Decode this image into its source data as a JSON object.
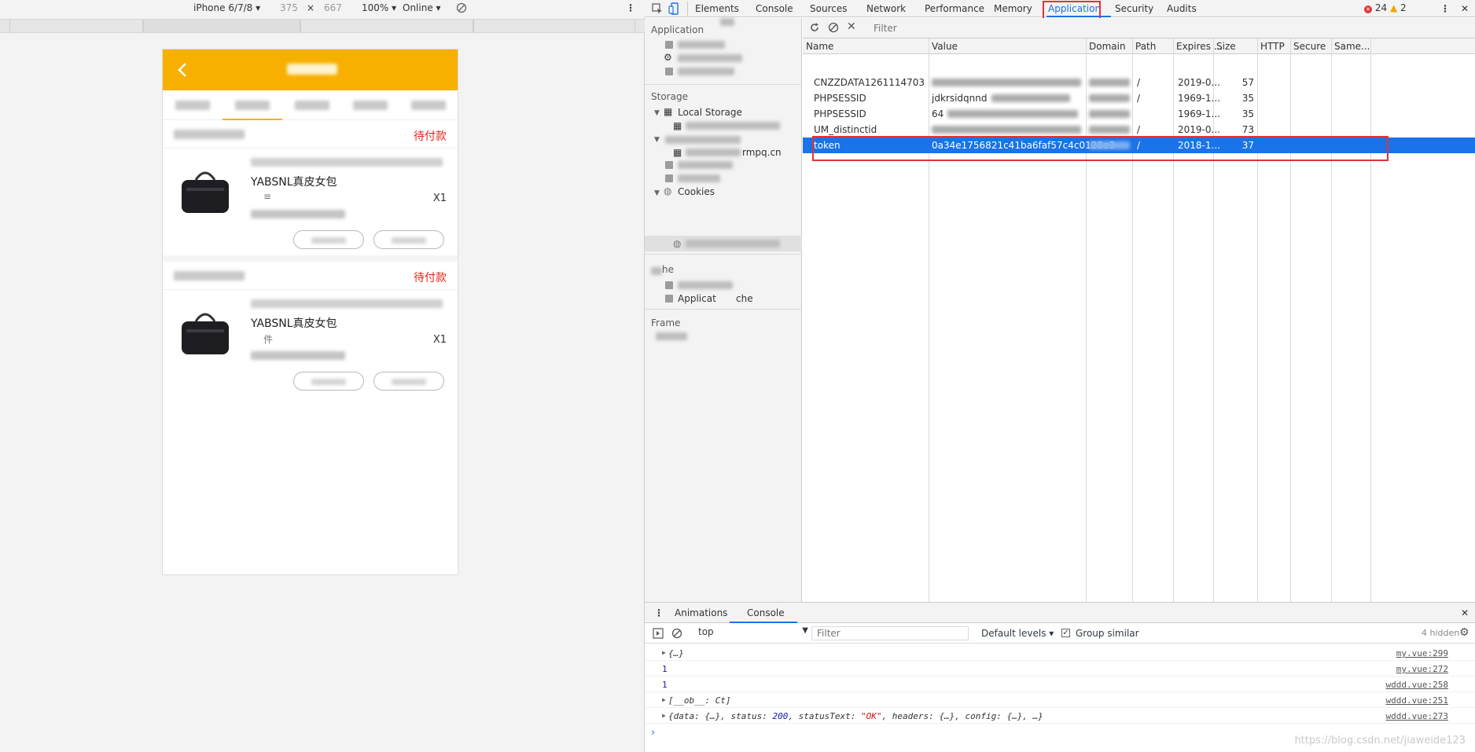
{
  "device_toolbar": {
    "device": "iPhone 6/7/8",
    "width": "375",
    "times": "×",
    "height": "667",
    "zoom": "100%",
    "network": "Online"
  },
  "phone": {
    "orders": [
      {
        "status": "待付款",
        "product_name": "YABSNL真皮女包",
        "spec": "≡",
        "qty": "X1"
      },
      {
        "status": "待付款",
        "product_name": "YABSNL真皮女包",
        "spec": "件",
        "qty": "X1"
      }
    ]
  },
  "devtools": {
    "tabs": [
      "Elements",
      "Console",
      "Sources",
      "Network",
      "Performance",
      "Memory",
      "Application",
      "Security",
      "Audits"
    ],
    "active_tab": "Application",
    "errors": "24",
    "warnings": "2",
    "sidebar": {
      "application_title": "Application",
      "storage_title": "Storage",
      "local_storage": "Local Storage",
      "session_url_tail": "rmpq.cn",
      "cookies": "Cookies",
      "cache_title_tail": "he",
      "app_cache_a": "Applicat",
      "app_cache_b": "che",
      "frames_title": "Frame"
    },
    "cookies": {
      "filter_placeholder": "Filter",
      "columns": [
        "Name",
        "Value",
        "Domain",
        "Path",
        "Expires ...",
        "Size",
        "HTTP",
        "Secure",
        "Same..."
      ],
      "rows": [
        {
          "name": "CNZZDATA1261114703",
          "value": "",
          "domain": "",
          "path": "/",
          "expires": "2019-0...",
          "size": "57"
        },
        {
          "name": "PHPSESSID",
          "value": "jdkrsidqnnd",
          "domain": "",
          "path": "/",
          "expires": "1969-1...",
          "size": "35"
        },
        {
          "name": "PHPSESSID",
          "value": "64",
          "domain": "",
          "path": "",
          "expires": "1969-1...",
          "size": "35"
        },
        {
          "name": "UM_distinctid",
          "value": "",
          "domain": "",
          "path": "/",
          "expires": "2019-0...",
          "size": "73"
        },
        {
          "name": "token",
          "value": "0a34e1756821c41ba6faf57c4c0128e3",
          "domain": "",
          "path": "/",
          "expires": "2018-1...",
          "size": "37"
        }
      ]
    },
    "drawer": {
      "tabs": [
        "Animations",
        "Console"
      ],
      "active_tab": "Console",
      "context": "top",
      "filter_placeholder": "Filter",
      "levels": "Default levels",
      "group_similar": "Group similar",
      "hidden": "4 hidden",
      "logs": [
        {
          "expandable": true,
          "message": "{…}",
          "source": "my.vue:299"
        },
        {
          "expandable": false,
          "message": "1",
          "source": "my.vue:272"
        },
        {
          "expandable": false,
          "message": "1",
          "source": "wddd.vue:258"
        },
        {
          "expandable": true,
          "message": "[__ob__: Ct]",
          "source": "wddd.vue:251"
        },
        {
          "expandable": true,
          "message_parts": [
            "{data: {…}, status: ",
            "200",
            ", statusText: ",
            "\"OK\"",
            ", headers: {…}, config: {…}, …}"
          ],
          "source": "wddd.vue:273"
        }
      ],
      "watermark": "https://blog.csdn.net/jiaweide123"
    }
  },
  "colors": {
    "accent_orange": "#f7b000",
    "status_red": "#e8231a",
    "selection_blue": "#1a73e8",
    "highlight_red": "#e23333"
  }
}
